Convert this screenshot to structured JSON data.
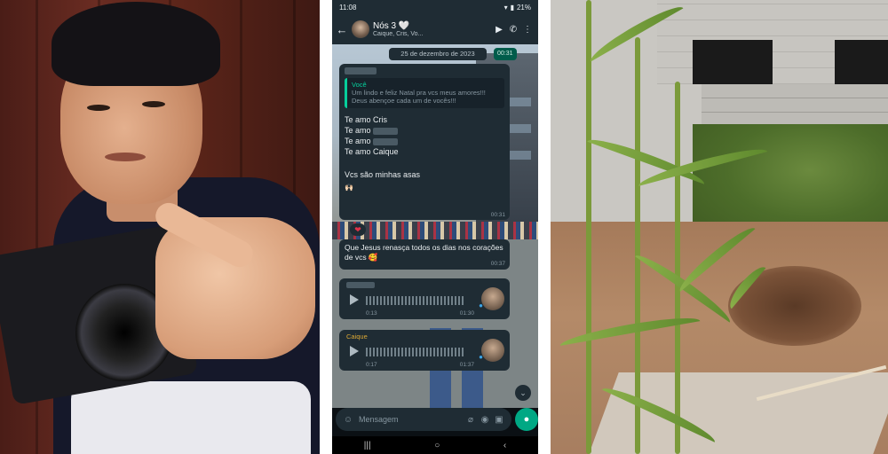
{
  "status_bar": {
    "time": "11:08",
    "battery": "21%"
  },
  "chat_header": {
    "title": "Nós 3 🤍",
    "subtitle": "Caique, Cris, Vo..."
  },
  "date_chip": "25 de dezembro de 2023",
  "time_chip": "00:31",
  "message1": {
    "quote_author": "Você",
    "quote_text": "Um lindo e feliz Natal pra vcs meus amores!!! Deus abençoe cada um de vocês!!!",
    "lines": [
      "Te amo Cris",
      "Te amo",
      "Te amo",
      "Te amo Caique",
      "Vcs são minhas asas"
    ],
    "emojis": "🙌🏻",
    "time": "00:31"
  },
  "reaction": "❤",
  "message2": {
    "text": "Que Jesus renasça todos os dias nos corações de vcs 🥰",
    "time": "00:37"
  },
  "voice1": {
    "duration": "0:13",
    "time": "01:30"
  },
  "voice2": {
    "sender": "Caique",
    "duration": "0:17",
    "time": "01:37"
  },
  "composer": {
    "placeholder": "Mensagem"
  },
  "icons": {
    "back": "arrow-left-icon",
    "video": "video-call-icon",
    "call": "phone-call-icon",
    "menu": "kebab-menu-icon",
    "emoji": "emoji-icon",
    "attach": "paperclip-icon",
    "camera": "camera-icon",
    "mic": "microphone-icon"
  },
  "colors": {
    "whatsapp_green": "#00a884",
    "bubble_dark": "#1f2c34",
    "quote_accent": "#06cf9c"
  }
}
